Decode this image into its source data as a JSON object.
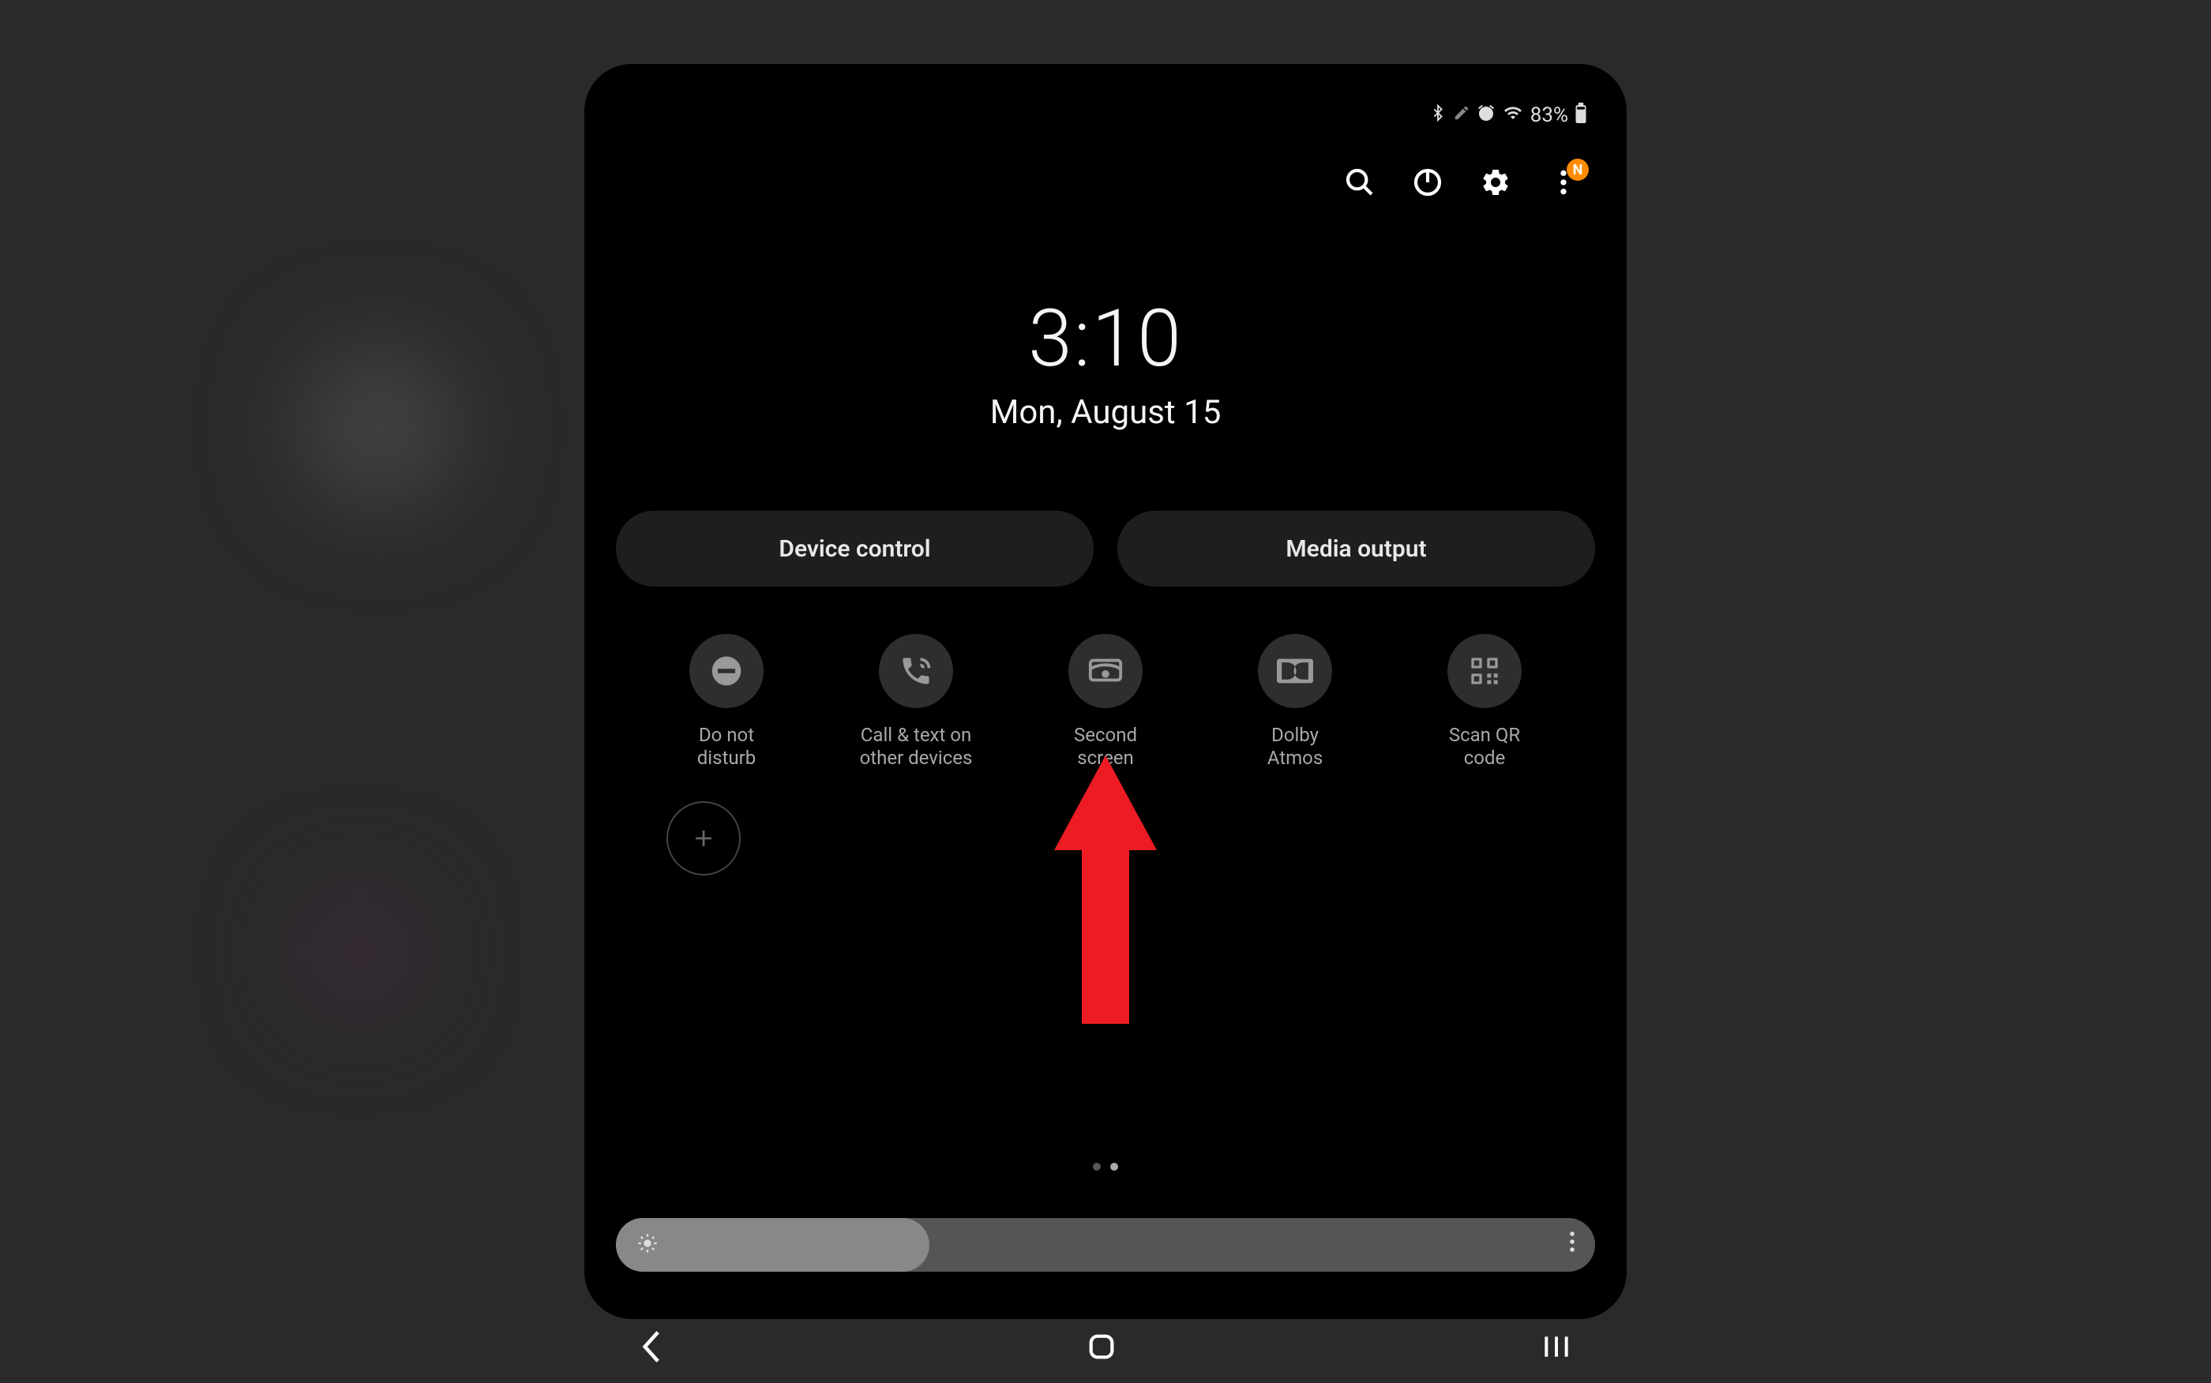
{
  "status": {
    "battery_pct": "83%",
    "notif_letter": "N"
  },
  "clock": {
    "time": "3:10",
    "date": "Mon, August 15"
  },
  "big_buttons": {
    "device_control": "Device control",
    "media_output": "Media output"
  },
  "toggles": [
    {
      "label": "Do not\ndisturb",
      "icon": "dnd"
    },
    {
      "label": "Call & text on\nother devices",
      "icon": "call-sync"
    },
    {
      "label": "Second\nscreen",
      "icon": "second-screen"
    },
    {
      "label": "Dolby\nAtmos",
      "icon": "dolby"
    },
    {
      "label": "Scan QR\ncode",
      "icon": "qr"
    }
  ],
  "brightness": {
    "value_pct": 32
  },
  "colors": {
    "accent": "#ff8c00",
    "annotation": "#ed1c24"
  }
}
